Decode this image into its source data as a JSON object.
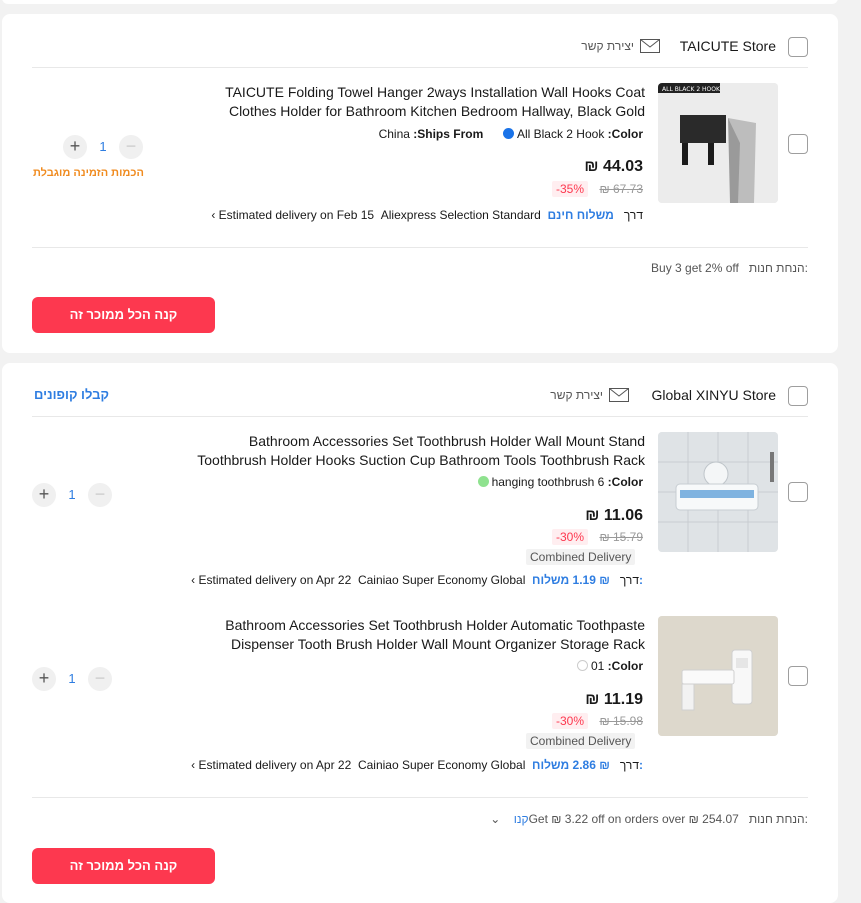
{
  "stores": [
    {
      "name": "TAICUTE Store",
      "contact_label": "יצירת קשר",
      "items": [
        {
          "title": "TAICUTE Folding Towel Hanger 2ways Installation Wall Hooks Coat Clothes Holder for Bathroom Kitchen Bedroom Hallway, Black Gold",
          "color_label": ":Color",
          "color_value": "All Black 2 Hook",
          "ships_from_label": ":Ships From",
          "ships_from_value": "China",
          "price": "44.03 ₪",
          "original_price": "67.73 ₪",
          "discount": "-35%",
          "shipping_label": "משלוח חינם",
          "shipping_via": "דרך",
          "carrier": "Aliexpress Selection Standard",
          "delivery": "Estimated delivery on Feb 15",
          "quantity": "1",
          "limit_note": "הכמות הזמינה מוגבלת"
        }
      ],
      "promo_label": "הנחת חנות:",
      "promo_text": "Buy 3 get 2% off",
      "buy_all_label": "קנה הכל ממוכר זה"
    },
    {
      "name": "Global XINYU Store",
      "contact_label": "יצירת קשר",
      "coupons_label": "קבלו קופונים",
      "items": [
        {
          "title": "Bathroom Accessories Set Toothbrush Holder Wall Mount Stand Toothbrush Holder Hooks Suction Cup Bathroom Tools Toothbrush Rack",
          "color_label": ":Color",
          "color_value": "hanging toothbrush 6",
          "price": "11.06 ₪",
          "original_price": "15.79 ₪",
          "discount": "-30%",
          "combined": "Combined Delivery",
          "shipping_label": "משלוח:",
          "shipping_cost": "₪ 1.19",
          "shipping_via": "דרך",
          "carrier": "Cainiao Super Economy Global",
          "delivery": "Estimated delivery on Apr 22",
          "quantity": "1"
        },
        {
          "title": "Bathroom Accessories Set Toothbrush Holder Automatic Toothpaste Dispenser Tooth Brush Holder Wall Mount Organizer Storage Rack",
          "color_label": ":Color",
          "color_value": "01",
          "price": "11.19 ₪",
          "original_price": "15.98 ₪",
          "discount": "-30%",
          "combined": "Combined Delivery",
          "shipping_label": "משלוח:",
          "shipping_cost": "₪ 2.86",
          "shipping_via": "דרך",
          "carrier": "Cainiao Super Economy Global",
          "delivery": "Estimated delivery on Apr 22",
          "quantity": "1"
        }
      ],
      "promo_label": "הנחת חנות:",
      "promo_text": "Get ₪ 3.22 off on orders over ₪ 254.07",
      "promo_link": "קנו",
      "buy_all_label": "קנה הכל ממוכר זה"
    }
  ],
  "colors": {
    "accent_red": "#fd384f",
    "link_blue": "#2e7de1",
    "limit_orange": "#f08b1f",
    "swatch_blue": "#1a73e8",
    "swatch_green": "#8fe28f"
  }
}
